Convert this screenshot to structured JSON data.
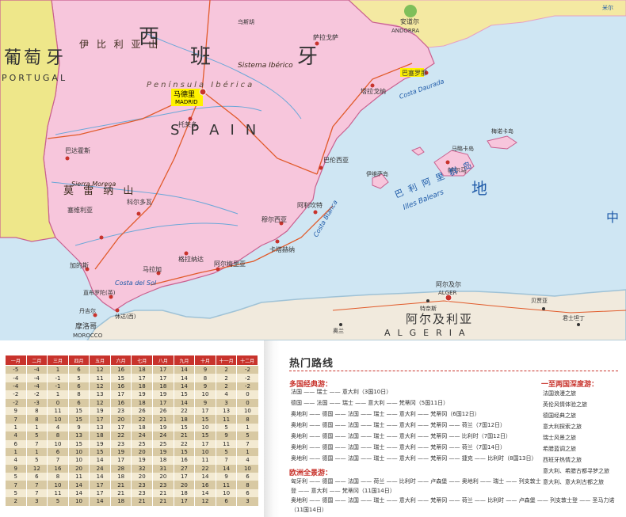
{
  "map": {
    "country_labels": {
      "spain_cn_1": "西",
      "spain_cn_2": "班",
      "spain_cn_3": "牙",
      "spain_en": "SPAIN",
      "portugal_cn_1": "葡",
      "portugal_cn_2": "萄",
      "portugal_cn_3": "牙",
      "portugal_en": "PORTUGAL",
      "algeria_cn": "阿尔及利亚",
      "algeria_en": "ALGERIA",
      "morocco_cn": "摩洛哥",
      "morocco_en": "MOROCCO",
      "andorra_cn": "安道尔",
      "andorra_en": "ANDORRA"
    },
    "cities": {
      "madrid_cn": "马德里",
      "madrid_en": "MADRID",
      "algiers_cn": "阿尔及尔",
      "algiers_en": "ALGER",
      "barcelona_cn": "巴塞罗那",
      "valencia_cn": "巴伦西亚",
      "alicante_cn": "阿利坎特",
      "murcia_cn": "穆尔西亚",
      "granada_cn": "格拉纳达",
      "malaga_cn": "马拉加",
      "sevilla_cn": "塞维利亚",
      "cordoba_cn": "科尔多瓦",
      "cadiz_cn": "加的斯",
      "almeria_cn": "阿尔梅里亚",
      "cartagena_cn": "卡塔赫纳",
      "toledo_cn": "托莱多",
      "zaragoza_cn": "萨拉戈萨",
      "tarragona_cn": "塔拉戈纳",
      "palma_cn": "帕尔马",
      "badajoz_cn": "巴达霍斯",
      "gibraltar_cn": "直布罗陀(英)",
      "ceuta_cn": "休达(西)",
      "tangier_cn": "丹吉尔",
      "oran_cn": "奥兰",
      "bejaia_cn": "贝贾亚",
      "constantine_cn": "君士坦丁",
      "tenes_cn": "特奈斯"
    },
    "regions": {
      "sierra_morena_cn": "莫 雷 纳 山",
      "sierra_morena_en": "Sierra Morena",
      "sistema_iberico_cn": "伊 比 利 亚 山",
      "sistema_iberico_en": "Sistema Ibérico",
      "balearic_cn": "巴 利 阿 里 群 岛",
      "balearic_en": "Illes Balears",
      "mallorca_cn": "马略卡岛",
      "menorca_cn": "梅诺卡岛",
      "ibiza_cn": "伊维萨岛",
      "med_sea_cn": "地",
      "zhong": "中",
      "costa_del_sol": "Costa del Sol",
      "costa_dorada": "Costa Daurada",
      "costa_blanca": "Costa Blanca",
      "peninsula_iberica": "Península Ibérica",
      "wuhu": "乌斯胡",
      "mil": "米尔"
    }
  },
  "temp_table": {
    "headers": [
      "一月",
      "二月",
      "三月",
      "四月",
      "五月",
      "六月",
      "七月",
      "八月",
      "九月",
      "十月",
      "十一月",
      "十二月"
    ],
    "rows": [
      [
        "-5",
        "-4",
        "1",
        "6",
        "12",
        "16",
        "18",
        "17",
        "14",
        "9",
        "2",
        "-2"
      ],
      [
        "-4",
        "-4",
        "-1",
        "5",
        "11",
        "15",
        "17",
        "17",
        "14",
        "8",
        "2",
        "-2"
      ],
      [
        "-4",
        "-4",
        "-1",
        "6",
        "12",
        "16",
        "18",
        "18",
        "14",
        "9",
        "2",
        "-2"
      ],
      [
        "-2",
        "-2",
        "1",
        "8",
        "13",
        "17",
        "19",
        "19",
        "15",
        "10",
        "4",
        "0"
      ],
      [
        "-2",
        "-3",
        "0",
        "6",
        "12",
        "16",
        "18",
        "17",
        "14",
        "9",
        "3",
        "0"
      ],
      [
        "9",
        "8",
        "11",
        "15",
        "19",
        "23",
        "26",
        "26",
        "22",
        "17",
        "13",
        "10"
      ],
      [
        "7",
        "8",
        "10",
        "15",
        "17",
        "20",
        "22",
        "21",
        "18",
        "15",
        "11",
        "8"
      ],
      [
        "1",
        "1",
        "4",
        "9",
        "13",
        "17",
        "18",
        "19",
        "15",
        "10",
        "5",
        "1"
      ],
      [
        "4",
        "5",
        "8",
        "13",
        "18",
        "22",
        "24",
        "24",
        "21",
        "15",
        "9",
        "5"
      ],
      [
        "6",
        "7",
        "10",
        "15",
        "19",
        "23",
        "25",
        "25",
        "22",
        "17",
        "11",
        "7"
      ],
      [
        "1",
        "1",
        "6",
        "10",
        "15",
        "19",
        "20",
        "19",
        "15",
        "10",
        "5",
        "1"
      ],
      [
        "4",
        "5",
        "7",
        "10",
        "14",
        "17",
        "19",
        "18",
        "16",
        "11",
        "7",
        "4"
      ],
      [
        "9",
        "12",
        "16",
        "20",
        "24",
        "28",
        "32",
        "31",
        "27",
        "22",
        "14",
        "10"
      ],
      [
        "5",
        "6",
        "8",
        "11",
        "14",
        "18",
        "20",
        "20",
        "17",
        "14",
        "9",
        "6"
      ],
      [
        "7",
        "7",
        "10",
        "14",
        "17",
        "21",
        "23",
        "23",
        "20",
        "16",
        "11",
        "8"
      ],
      [
        "5",
        "7",
        "11",
        "14",
        "17",
        "21",
        "23",
        "21",
        "18",
        "14",
        "10",
        "6"
      ],
      [
        "2",
        "3",
        "5",
        "10",
        "14",
        "18",
        "21",
        "21",
        "17",
        "12",
        "6",
        "3"
      ]
    ]
  },
  "routes": {
    "title": "热门路线",
    "multi_country": {
      "heading": "多国经典游：",
      "lines": [
        "法国 —— 瑞士 —— 意大利（3国10日）",
        "德国 —— 法国 —— 瑞士 —— 意大利 —— 梵蒂冈（5国11日）",
        "奥地利 —— 德国 —— 法国 —— 瑞士 —— 意大利 —— 梵蒂冈（6国12日）",
        "奥地利 —— 德国 —— 法国 —— 瑞士 —— 意大利 —— 梵蒂冈 —— 荷兰（7国12日）",
        "奥地利 —— 德国 —— 法国 —— 瑞士 —— 意大利 —— 梵蒂冈 —— 比利时（7国12日）",
        "奥地利 —— 德国 —— 法国 —— 瑞士 —— 意大利 —— 梵蒂冈 —— 荷兰（7国14日）",
        "奥地利 —— 德国 —— 法国 —— 瑞士 —— 意大利 —— 梵蒂冈 —— 捷克 —— 比利时（8国13日）"
      ]
    },
    "europe_tour": {
      "heading": "欧洲全景游：",
      "lines": [
        "匈牙利 —— 德国 —— 法国 —— 荷兰 —— 比利时 —— 卢森堡 —— 奥地利 —— 瑞士 —— 列支敦士",
        "登 —— 意大利 —— 梵蒂冈（11国14日）",
        "奥地利 —— 德国 —— 法国 —— 瑞士 —— 意大利 —— 梵蒂冈 —— 荷兰 —— 比利时 —— 卢森堡 —— 列支敦士登 —— 圣马力诺",
        "（11国14日）"
      ]
    },
    "deep_tour": {
      "heading": "一至两国深度游：",
      "items": [
        "法国浪漫之旅",
        "英伦风情体验之旅",
        "德国经典之旅",
        "意大利探索之旅",
        "瑞士风景之旅",
        "希腊蓝调之旅",
        "西班牙热情之旅",
        "意大利、希腊古都寻梦之旅",
        "意大利、意大利古都之旅"
      ]
    }
  },
  "colors": {
    "sea": "#cfe6f3",
    "spain": "#f7c6dc",
    "portugal": "#eee78a",
    "france": "#f4e9a2",
    "africa": "#f1eadd",
    "accent_red": "#c8332c",
    "capital_box": "#fff200"
  }
}
